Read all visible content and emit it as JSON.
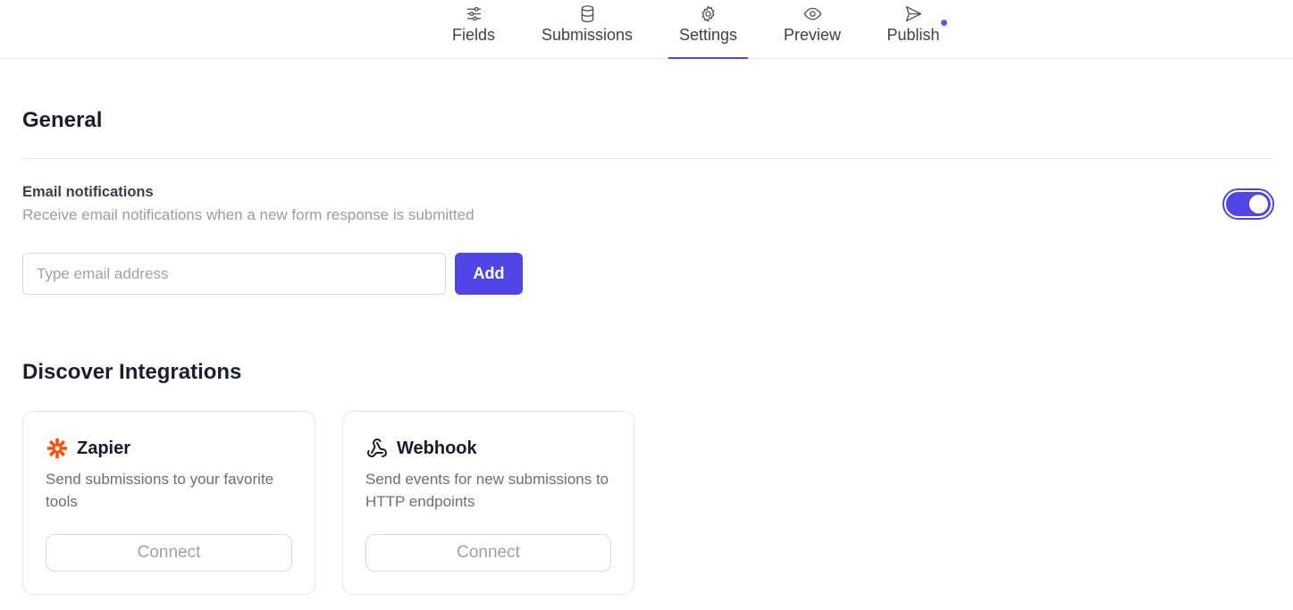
{
  "tabs": [
    {
      "label": "Fields",
      "icon": "sliders-icon"
    },
    {
      "label": "Submissions",
      "icon": "database-icon"
    },
    {
      "label": "Settings",
      "icon": "gear-icon",
      "active": true
    },
    {
      "label": "Preview",
      "icon": "eye-icon"
    },
    {
      "label": "Publish",
      "icon": "send-icon",
      "has_indicator": true
    }
  ],
  "general": {
    "heading": "General",
    "email_notifications": {
      "title": "Email notifications",
      "description": "Receive email notifications when a new form response is submitted",
      "enabled": true
    },
    "email_input": {
      "value": "",
      "placeholder": "Type email address"
    },
    "add_label": "Add"
  },
  "integrations": {
    "heading": "Discover Integrations",
    "items": [
      {
        "name": "Zapier",
        "icon": "zapier-icon",
        "description": "Send submissions to your favorite tools",
        "button": "Connect"
      },
      {
        "name": "Webhook",
        "icon": "webhook-icon",
        "description": "Send events for new submissions to HTTP endpoints",
        "button": "Connect"
      }
    ]
  },
  "colors": {
    "accent": "#4f46e5",
    "zapier": "#ff4f00",
    "indicator": "#5b5be8"
  }
}
